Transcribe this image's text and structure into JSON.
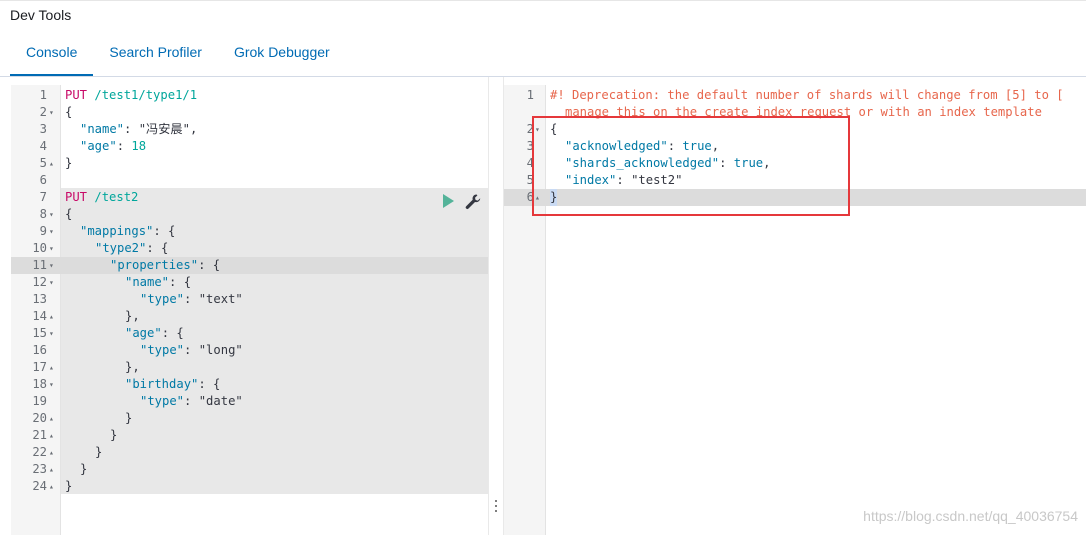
{
  "app": {
    "title": "Dev Tools"
  },
  "tabs": [
    {
      "label": "Console",
      "active": true
    },
    {
      "label": "Search Profiler",
      "active": false
    },
    {
      "label": "Grok Debugger",
      "active": false
    }
  ],
  "request_editor": {
    "lines": [
      {
        "n": "1",
        "fold": "",
        "indent": 0,
        "tokens": [
          [
            "method",
            "PUT"
          ],
          [
            "punc",
            " "
          ],
          [
            "url",
            "/test1/type1/1"
          ]
        ]
      },
      {
        "n": "2",
        "fold": "▾",
        "indent": 0,
        "tokens": [
          [
            "punc",
            "{"
          ]
        ]
      },
      {
        "n": "3",
        "fold": "",
        "indent": 1,
        "tokens": [
          [
            "key",
            "\"name\""
          ],
          [
            "punc",
            ": "
          ],
          [
            "str2",
            "\"冯安晨\""
          ],
          [
            "punc",
            ","
          ]
        ]
      },
      {
        "n": "4",
        "fold": "",
        "indent": 1,
        "tokens": [
          [
            "key",
            "\"age\""
          ],
          [
            "punc",
            ": "
          ],
          [
            "num",
            "18"
          ]
        ]
      },
      {
        "n": "5",
        "fold": "▴",
        "indent": 0,
        "tokens": [
          [
            "punc",
            "}"
          ]
        ]
      },
      {
        "n": "6",
        "fold": "",
        "indent": 0,
        "tokens": []
      },
      {
        "n": "7",
        "fold": "",
        "indent": 0,
        "tokens": [
          [
            "method",
            "PUT"
          ],
          [
            "punc",
            " "
          ],
          [
            "url",
            "/test2"
          ]
        ]
      },
      {
        "n": "8",
        "fold": "▾",
        "indent": 0,
        "tokens": [
          [
            "punc",
            "{"
          ]
        ]
      },
      {
        "n": "9",
        "fold": "▾",
        "indent": 1,
        "tokens": [
          [
            "key",
            "\"mappings\""
          ],
          [
            "punc",
            ": {"
          ]
        ]
      },
      {
        "n": "10",
        "fold": "▾",
        "indent": 2,
        "tokens": [
          [
            "key",
            "\"type2\""
          ],
          [
            "punc",
            ": {"
          ]
        ]
      },
      {
        "n": "11",
        "fold": "▾",
        "indent": 3,
        "tokens": [
          [
            "key",
            "\"properties\""
          ],
          [
            "punc",
            ": {"
          ]
        ]
      },
      {
        "n": "12",
        "fold": "▾",
        "indent": 4,
        "tokens": [
          [
            "key",
            "\"name\""
          ],
          [
            "punc",
            ": {"
          ]
        ]
      },
      {
        "n": "13",
        "fold": "",
        "indent": 5,
        "tokens": [
          [
            "key",
            "\"type\""
          ],
          [
            "punc",
            ": "
          ],
          [
            "str2",
            "\"text\""
          ]
        ]
      },
      {
        "n": "14",
        "fold": "▴",
        "indent": 4,
        "tokens": [
          [
            "punc",
            "},"
          ]
        ]
      },
      {
        "n": "15",
        "fold": "▾",
        "indent": 4,
        "tokens": [
          [
            "key",
            "\"age\""
          ],
          [
            "punc",
            ": {"
          ]
        ]
      },
      {
        "n": "16",
        "fold": "",
        "indent": 5,
        "tokens": [
          [
            "key",
            "\"type\""
          ],
          [
            "punc",
            ": "
          ],
          [
            "str2",
            "\"long\""
          ]
        ]
      },
      {
        "n": "17",
        "fold": "▴",
        "indent": 4,
        "tokens": [
          [
            "punc",
            "},"
          ]
        ]
      },
      {
        "n": "18",
        "fold": "▾",
        "indent": 4,
        "tokens": [
          [
            "key",
            "\"birthday\""
          ],
          [
            "punc",
            ": {"
          ]
        ]
      },
      {
        "n": "19",
        "fold": "",
        "indent": 5,
        "tokens": [
          [
            "key",
            "\"type\""
          ],
          [
            "punc",
            ": "
          ],
          [
            "str2",
            "\"date\""
          ]
        ]
      },
      {
        "n": "20",
        "fold": "▴",
        "indent": 4,
        "tokens": [
          [
            "punc",
            "}"
          ]
        ]
      },
      {
        "n": "21",
        "fold": "▴",
        "indent": 3,
        "tokens": [
          [
            "punc",
            "}"
          ]
        ]
      },
      {
        "n": "22",
        "fold": "▴",
        "indent": 2,
        "tokens": [
          [
            "punc",
            "}"
          ]
        ]
      },
      {
        "n": "23",
        "fold": "▴",
        "indent": 1,
        "tokens": [
          [
            "punc",
            "}"
          ]
        ]
      },
      {
        "n": "24",
        "fold": "▴",
        "indent": 0,
        "tokens": [
          [
            "punc",
            "}"
          ]
        ]
      }
    ]
  },
  "response_editor": {
    "lines": [
      {
        "n": "1",
        "fold": "",
        "indent": 0,
        "tokens": [
          [
            "comment",
            "#! Deprecation: the default number of shards will change from [5] to ["
          ]
        ]
      },
      {
        "n": "",
        "fold": "",
        "indent": 1,
        "tokens": [
          [
            "comment",
            "manage this on the create index request or with an index template"
          ]
        ]
      },
      {
        "n": "2",
        "fold": "▾",
        "indent": 0,
        "tokens": [
          [
            "punc",
            "{"
          ]
        ]
      },
      {
        "n": "3",
        "fold": "",
        "indent": 1,
        "tokens": [
          [
            "key",
            "\"acknowledged\""
          ],
          [
            "punc",
            ": "
          ],
          [
            "bool",
            "true"
          ],
          [
            "punc",
            ","
          ]
        ]
      },
      {
        "n": "4",
        "fold": "",
        "indent": 1,
        "tokens": [
          [
            "key",
            "\"shards_acknowledged\""
          ],
          [
            "punc",
            ": "
          ],
          [
            "bool",
            "true"
          ],
          [
            "punc",
            ","
          ]
        ]
      },
      {
        "n": "5",
        "fold": "",
        "indent": 1,
        "tokens": [
          [
            "key",
            "\"index\""
          ],
          [
            "punc",
            ": "
          ],
          [
            "str2",
            "\"test2\""
          ]
        ]
      },
      {
        "n": "6",
        "fold": "▴",
        "indent": 0,
        "tokens": [
          [
            "punc",
            "}"
          ]
        ]
      }
    ]
  },
  "watermark": "https://blog.csdn.net/qq_40036754",
  "colors": {
    "accent": "#006bb4",
    "run_green": "#54b399",
    "annotation_red": "#e5383b"
  },
  "icons": {
    "run": "play-icon",
    "settings": "wrench-icon"
  }
}
